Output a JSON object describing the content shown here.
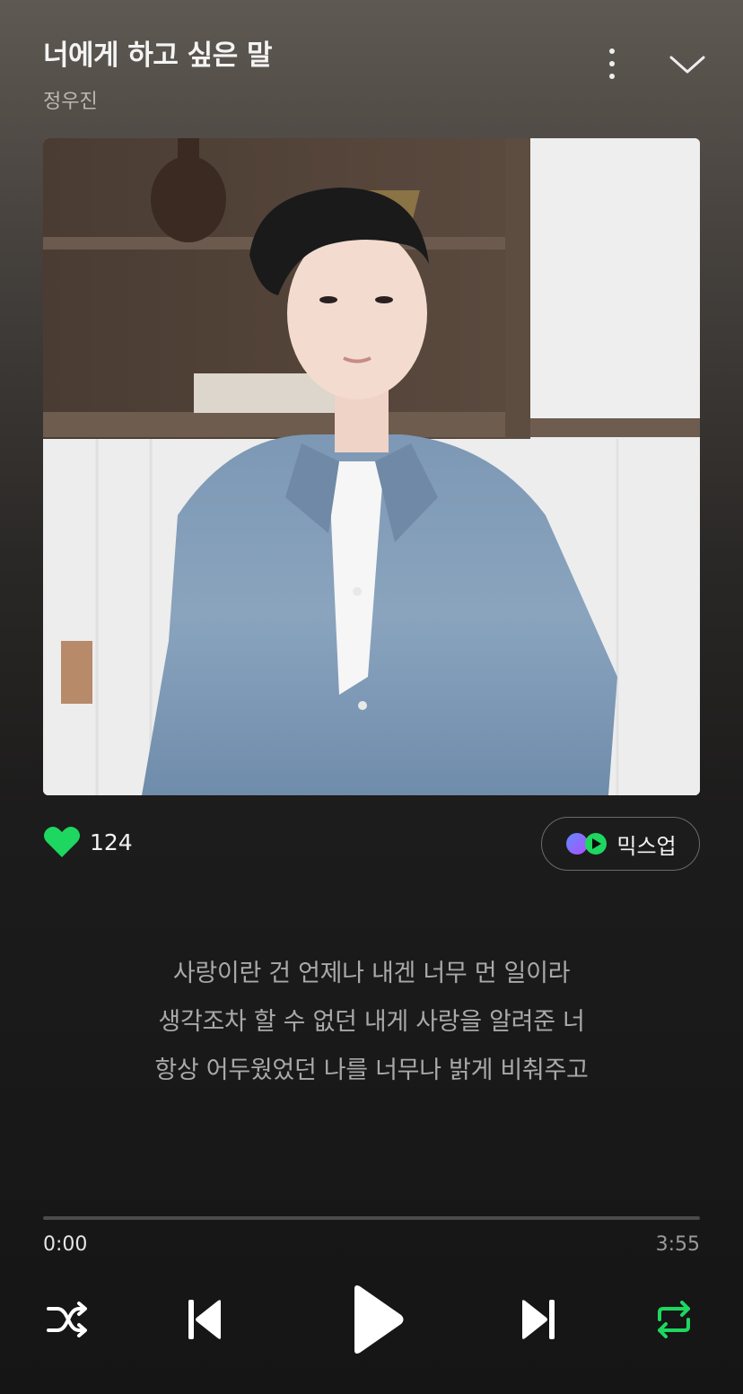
{
  "track": {
    "title": "너에게 하고 싶은 말",
    "artist": "정우진"
  },
  "icons": {
    "more": "more-vertical-icon",
    "collapse": "chevron-down-icon",
    "like": "heart-icon",
    "mixup": "mixup-icon",
    "shuffle": "shuffle-icon",
    "previous": "skip-previous-icon",
    "play": "play-icon",
    "next": "skip-next-icon",
    "repeat": "repeat-icon"
  },
  "like": {
    "count": "124",
    "color": "#1ed760"
  },
  "mixup": {
    "label": "믹스업"
  },
  "lyrics": [
    "사랑이란 건 언제나 내겐 너무 먼 일이라",
    "생각조차 할 수 없던 내게 사랑을 알려준 너",
    "항상 어두웠었던 나를 너무나 밝게 비춰주고"
  ],
  "playback": {
    "current_time": "0:00",
    "total_time": "3:55",
    "progress": 0,
    "repeat_color": "#1ed760"
  }
}
